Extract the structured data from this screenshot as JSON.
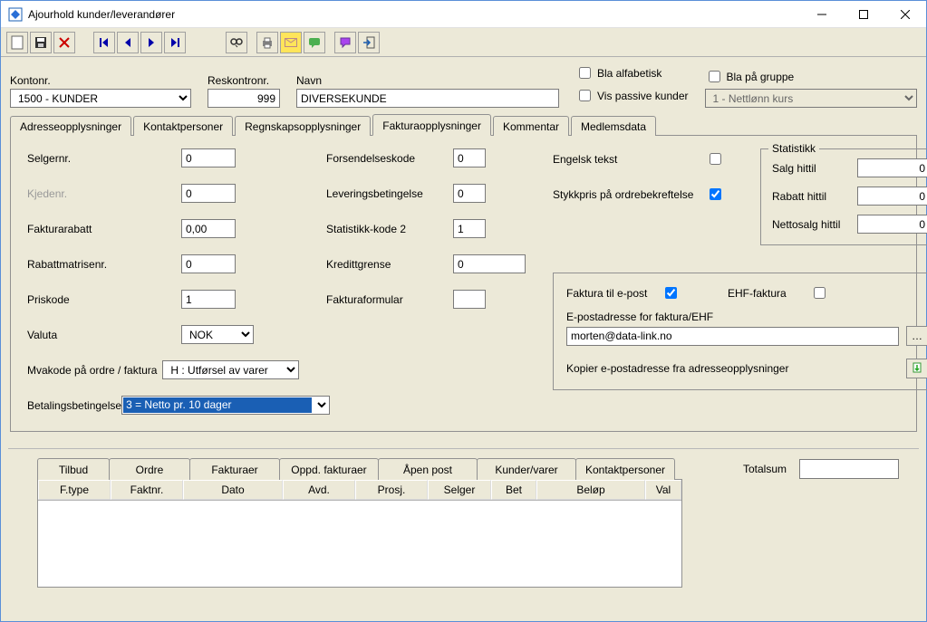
{
  "window": {
    "title": "Ajourhold kunder/leverandører"
  },
  "header": {
    "kontonr_label": "Kontonr.",
    "kontonr_value": "1500 - KUNDER",
    "reskontronr_label": "Reskontronr.",
    "reskontronr_value": "999",
    "navn_label": "Navn",
    "navn_value": "DIVERSEKUNDE",
    "bla_alfabetisk": "Bla alfabetisk",
    "vis_passive": "Vis passive kunder",
    "bla_gruppe": "Bla på gruppe",
    "gruppe_value": "1  - Nettlønn kurs"
  },
  "tabs": {
    "adresse": "Adresseopplysninger",
    "kontakt": "Kontaktpersoner",
    "regnskap": "Regnskapsopplysninger",
    "faktura": "Fakturaopplysninger",
    "kommentar": "Kommentar",
    "medlem": "Medlemsdata"
  },
  "form": {
    "selgernr_label": "Selgernr.",
    "selgernr": "0",
    "kjedenr_label": "Kjedenr.",
    "kjedenr": "0",
    "fakturarabatt_label": "Fakturarabatt",
    "fakturarabatt": "0,00",
    "rabattmatrisenr_label": "Rabattmatrisenr.",
    "rabattmatrisenr": "0",
    "priskode_label": "Priskode",
    "priskode": "1",
    "valuta_label": "Valuta",
    "valuta": "NOK",
    "mvakode_label": "Mvakode på ordre / faktura",
    "mvakode": "H : Utførsel av varer",
    "betaling_label": "Betalingsbetingelse",
    "betaling": "3 = Netto pr.  10 dager",
    "forsend_label": "Forsendelseskode",
    "forsend": "0",
    "levering_label": "Leveringsbetingelse",
    "levering": "0",
    "stat2_label": "Statistikk-kode 2",
    "stat2": "1",
    "kreditt_label": "Kredittgrense",
    "kreditt": "0",
    "fform_label": "Fakturaformular",
    "fform": "",
    "engelsk_label": "Engelsk tekst",
    "stykkpris_label": "Stykkpris på ordrebekreftelse",
    "statistikk_title": "Statistikk",
    "salg_label": "Salg hittil",
    "salg": "0",
    "rabatt_label": "Rabatt hittil",
    "rabatt": "0",
    "nettosalg_label": "Nettosalg hittil",
    "nettosalg": "0",
    "faktura_epost_label": "Faktura til e-post",
    "ehf_label": "EHF-faktura",
    "epost_addr_label": "E-postadresse for faktura/EHF",
    "epost_addr": "morten@data-link.no",
    "kopier_label": "Kopier e-postadresse fra adresseopplysninger"
  },
  "subtabs": {
    "tilbud": "Tilbud",
    "ordre": "Ordre",
    "fakturaer": "Fakturaer",
    "oppd": "Oppd. fakturaer",
    "apen": "Åpen post",
    "kundervarer": "Kunder/varer",
    "kontakt": "Kontaktpersoner",
    "totalsum": "Totalsum"
  },
  "grid_cols": {
    "ftype": "F.type",
    "faktnr": "Faktnr.",
    "dato": "Dato",
    "avd": "Avd.",
    "prosj": "Prosj.",
    "selger": "Selger",
    "bet": "Bet",
    "belop": "Beløp",
    "val": "Val"
  }
}
